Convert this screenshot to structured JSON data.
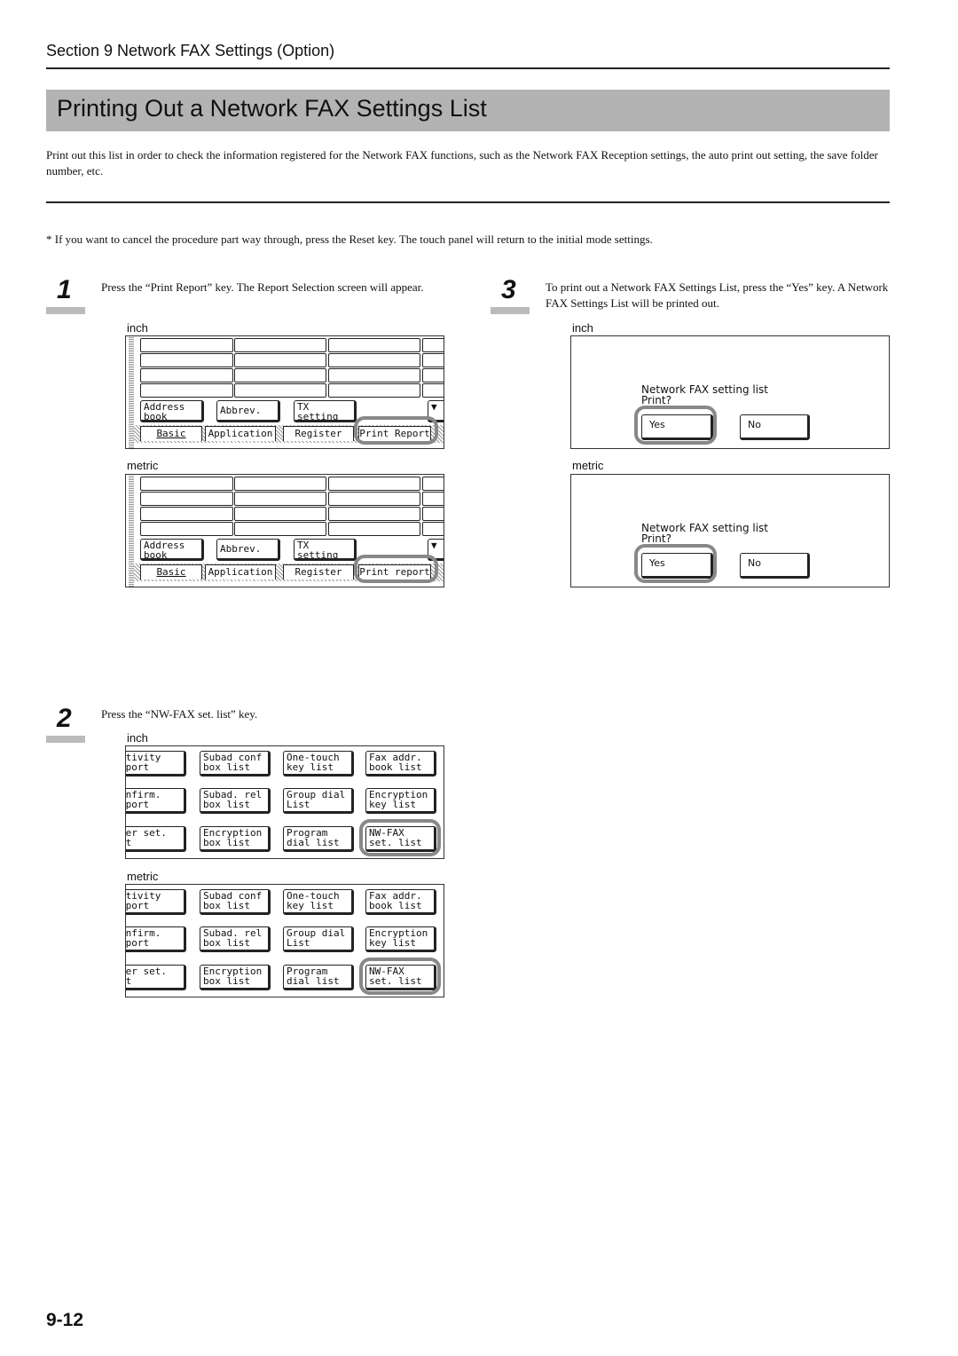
{
  "header": {
    "section": "Section 9  Network FAX Settings (Option)"
  },
  "title": "Printing Out a Network FAX Settings List",
  "intro": "Print out this list in order to check the information registered for the Network FAX functions, such as the Network FAX Reception settings, the auto print out setting, the save folder number, etc.",
  "note": "* If you want to cancel the procedure part way through, press the Reset key. The touch panel will return to the initial mode settings.",
  "steps": [
    {
      "number": "1",
      "text": "Press the “Print Report” key. The Report Selection screen will appear."
    },
    {
      "number": "2",
      "text": "Press the “NW-FAX set. list” key."
    },
    {
      "number": "3",
      "text": "To print out a Network FAX Settings List, press the “Yes” key. A Network FAX Settings List will be printed out."
    }
  ],
  "labels": {
    "inch": "inch",
    "metric": "metric"
  },
  "screen1": {
    "keys": [
      "Address\nbook",
      "Abbrev.",
      "TX\nsetting"
    ],
    "tabs_inch": [
      "Basic",
      "Application",
      "Register",
      "Print Report"
    ],
    "tabs_metric": [
      "Basic",
      "Application",
      "Register",
      "Print report"
    ]
  },
  "screen2": {
    "keys": [
      [
        "ctivity\neport",
        "Subad conf\nbox list",
        "One-touch\nkey list",
        "Fax addr.\nbook list"
      ],
      [
        "onfirm.\neport",
        "Subad. rel\nbox list",
        "Group dial\nList",
        "Encryption\nkey list"
      ],
      [
        "ser set.\nst",
        "Encryption\nbox list",
        "Program\ndial list",
        "NW-FAX\nset. list"
      ]
    ]
  },
  "screen3": {
    "line1": "Network FAX setting list",
    "line2": "Print?",
    "yes": "Yes",
    "no": "No"
  },
  "page_number": "9-12",
  "colors": {
    "title_bar": "#b3b3b3",
    "highlight": "#888888"
  }
}
